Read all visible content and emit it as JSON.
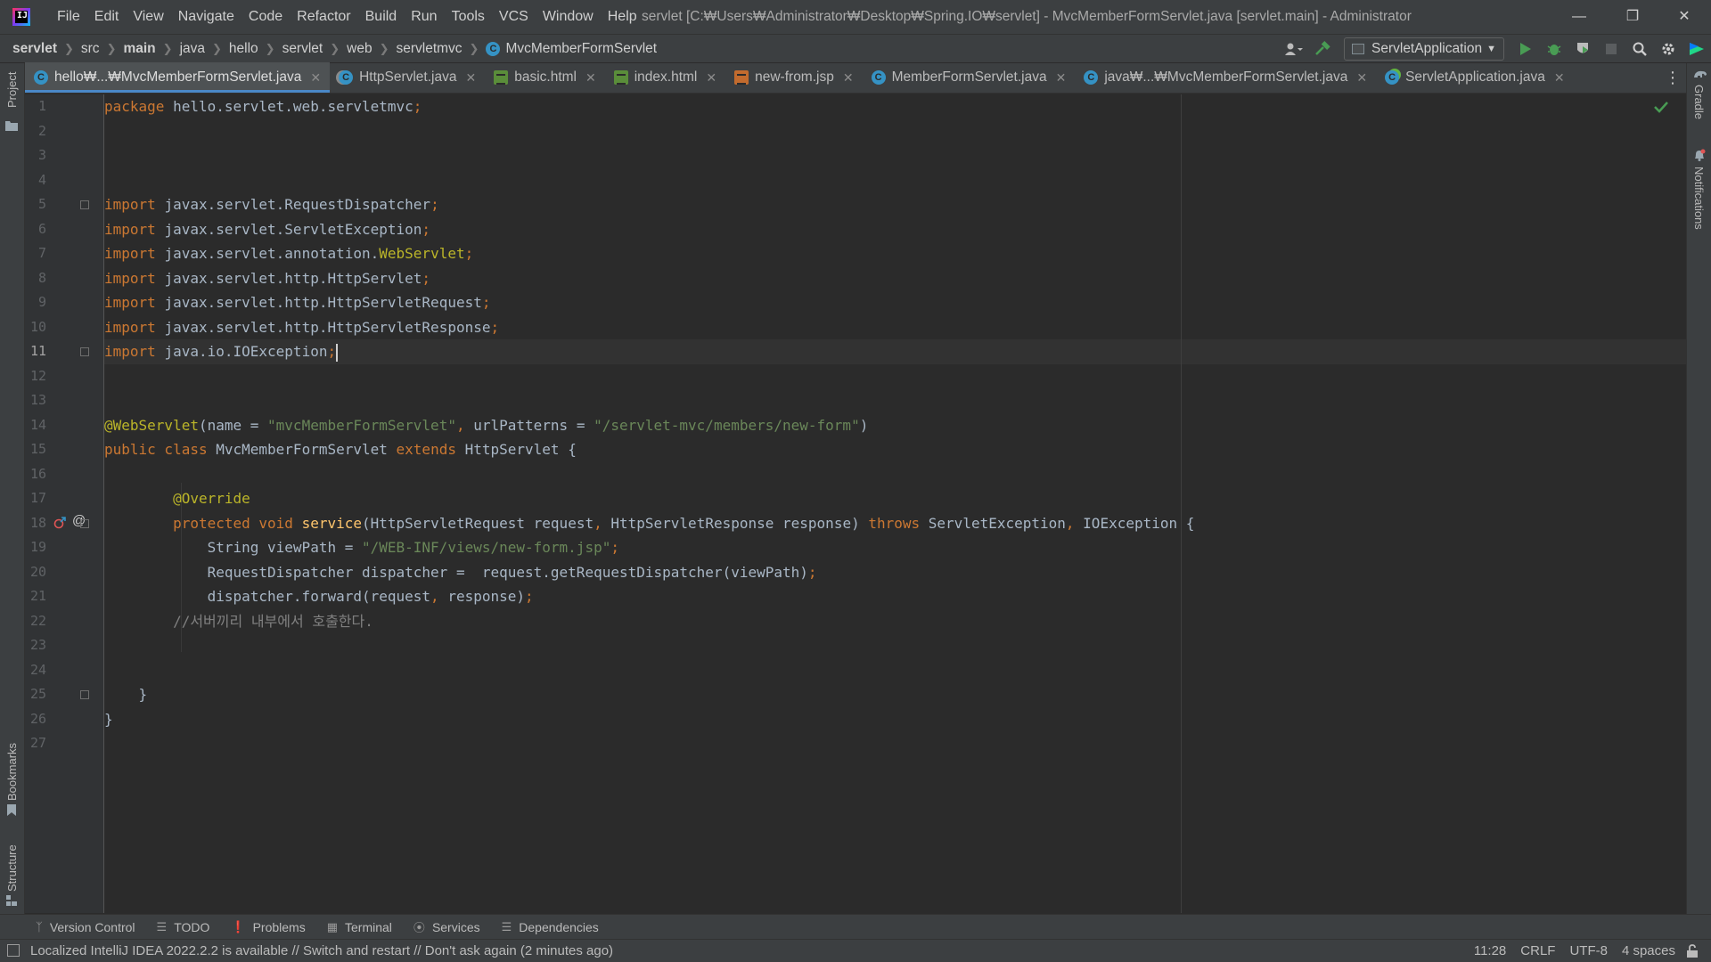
{
  "window": {
    "title": "servlet [C:₩Users₩Administrator₩Desktop₩Spring.IO₩servlet] - MvcMemberFormServlet.java [servlet.main] - Administrator",
    "menu": [
      "File",
      "Edit",
      "View",
      "Navigate",
      "Code",
      "Refactor",
      "Build",
      "Run",
      "Tools",
      "VCS",
      "Window",
      "Help"
    ]
  },
  "breadcrumb": [
    "servlet",
    "src",
    "main",
    "java",
    "hello",
    "servlet",
    "web",
    "servletmvc",
    "MvcMemberFormServlet"
  ],
  "run_config": "ServletApplication",
  "tabs": [
    {
      "label": "hello₩...₩MvcMemberFormServlet.java",
      "icon": "class-icon",
      "active": true
    },
    {
      "label": "HttpServlet.java",
      "icon": "library-class-icon"
    },
    {
      "label": "basic.html",
      "icon": "html-file-icon"
    },
    {
      "label": "index.html",
      "icon": "html-file-icon"
    },
    {
      "label": "new-from.jsp",
      "icon": "jsp-file-icon"
    },
    {
      "label": "MemberFormServlet.java",
      "icon": "class-icon"
    },
    {
      "label": "java₩...₩MvcMemberFormServlet.java",
      "icon": "class-icon"
    },
    {
      "label": "ServletApplication.java",
      "icon": "spring-boot-class-icon"
    }
  ],
  "side_tools": {
    "left": [
      "Project",
      "Bookmarks",
      "Structure"
    ],
    "right": [
      "Gradle",
      "Notifications"
    ]
  },
  "editor": {
    "current_line": 11,
    "lines": [
      {
        "n": "1",
        "tokens": [
          [
            "kw",
            "package "
          ],
          [
            "tx",
            "hello.servlet.web.servletmvc"
          ],
          [
            "punct",
            ";"
          ]
        ]
      },
      {
        "n": "2",
        "tokens": []
      },
      {
        "n": "3",
        "tokens": []
      },
      {
        "n": "4",
        "tokens": []
      },
      {
        "n": "5",
        "tokens": [
          [
            "kw",
            "import "
          ],
          [
            "tx",
            "javax.servlet.RequestDispatcher"
          ],
          [
            "punct",
            ";"
          ]
        ]
      },
      {
        "n": "6",
        "tokens": [
          [
            "kw",
            "import "
          ],
          [
            "tx",
            "javax.servlet.ServletException"
          ],
          [
            "punct",
            ";"
          ]
        ]
      },
      {
        "n": "7",
        "tokens": [
          [
            "kw",
            "import "
          ],
          [
            "tx",
            "javax.servlet.annotation."
          ],
          [
            "ann",
            "WebServlet"
          ],
          [
            "punct",
            ";"
          ]
        ]
      },
      {
        "n": "8",
        "tokens": [
          [
            "kw",
            "import "
          ],
          [
            "tx",
            "javax.servlet.http.HttpServlet"
          ],
          [
            "punct",
            ";"
          ]
        ]
      },
      {
        "n": "9",
        "tokens": [
          [
            "kw",
            "import "
          ],
          [
            "tx",
            "javax.servlet.http.HttpServletRequest"
          ],
          [
            "punct",
            ";"
          ]
        ]
      },
      {
        "n": "10",
        "tokens": [
          [
            "kw",
            "import "
          ],
          [
            "tx",
            "javax.servlet.http.HttpServletResponse"
          ],
          [
            "punct",
            ";"
          ]
        ]
      },
      {
        "n": "11",
        "tokens": [
          [
            "kw",
            "import "
          ],
          [
            "tx",
            "java.io.IOException"
          ],
          [
            "punct",
            ";"
          ]
        ]
      },
      {
        "n": "12",
        "tokens": []
      },
      {
        "n": "13",
        "tokens": []
      },
      {
        "n": "14",
        "tokens": [
          [
            "ann",
            "@WebServlet"
          ],
          [
            "tx",
            "(name = "
          ],
          [
            "str",
            "\"mvcMemberFormServlet\""
          ],
          [
            "punct",
            ", "
          ],
          [
            "tx",
            "urlPatterns = "
          ],
          [
            "str",
            "\"/servlet-mvc/members/new-form\""
          ],
          [
            "tx",
            ")"
          ]
        ]
      },
      {
        "n": "15",
        "tokens": [
          [
            "kw",
            "public class "
          ],
          [
            "tx",
            "MvcMemberFormServlet "
          ],
          [
            "kw",
            "extends "
          ],
          [
            "tx",
            "HttpServlet {"
          ]
        ]
      },
      {
        "n": "16",
        "tokens": []
      },
      {
        "n": "17",
        "tokens": [
          [
            "tx",
            "        "
          ],
          [
            "ann",
            "@Override"
          ]
        ]
      },
      {
        "n": "18",
        "tokens": [
          [
            "tx",
            "        "
          ],
          [
            "kw",
            "protected void "
          ],
          [
            "mname",
            "service"
          ],
          [
            "tx",
            "(HttpServletRequest request"
          ],
          [
            "punct",
            ", "
          ],
          [
            "tx",
            "HttpServletResponse response) "
          ],
          [
            "kw",
            "throws "
          ],
          [
            "tx",
            "ServletException"
          ],
          [
            "punct",
            ", "
          ],
          [
            "tx",
            "IOException {"
          ]
        ]
      },
      {
        "n": "19",
        "tokens": [
          [
            "tx",
            "            String viewPath = "
          ],
          [
            "str",
            "\"/WEB-INF/views/new-form.jsp\""
          ],
          [
            "punct",
            ";"
          ]
        ]
      },
      {
        "n": "20",
        "tokens": [
          [
            "tx",
            "            RequestDispatcher dispatcher =  request.getRequestDispatcher(viewPath)"
          ],
          [
            "punct",
            ";"
          ]
        ]
      },
      {
        "n": "21",
        "tokens": [
          [
            "tx",
            "            dispatcher.forward(request"
          ],
          [
            "punct",
            ", "
          ],
          [
            "tx",
            "response)"
          ],
          [
            "punct",
            ";"
          ]
        ]
      },
      {
        "n": "22",
        "tokens": [
          [
            "cmt",
            "        //서버끼리 내부에서 호출한다."
          ]
        ]
      },
      {
        "n": "23",
        "tokens": []
      },
      {
        "n": "24",
        "tokens": []
      },
      {
        "n": "25",
        "tokens": [
          [
            "tx",
            "    }"
          ]
        ]
      },
      {
        "n": "26",
        "tokens": [
          [
            "tx",
            "}"
          ]
        ]
      },
      {
        "n": "27",
        "tokens": []
      }
    ]
  },
  "bottom_tools": [
    {
      "label": "Version Control",
      "icon": "branch-icon"
    },
    {
      "label": "TODO",
      "icon": "list-icon"
    },
    {
      "label": "Problems",
      "icon": "problems-icon"
    },
    {
      "label": "Terminal",
      "icon": "terminal-icon"
    },
    {
      "label": "Services",
      "icon": "services-icon"
    },
    {
      "label": "Dependencies",
      "icon": "dependencies-icon"
    }
  ],
  "status": {
    "message": "Localized IntelliJ IDEA 2022.2.2 is available // Switch and restart // Don't ask again (2 minutes ago)",
    "position": "11:28",
    "line_separator": "CRLF",
    "encoding": "UTF-8",
    "indent": "4 spaces"
  },
  "colors": {
    "keyword": "#cc7832",
    "string": "#6a8759",
    "annotation": "#bbb529",
    "comment": "#808080",
    "text": "#a9b7c6",
    "method": "#ffc66d",
    "accent": "#4a88c7"
  }
}
